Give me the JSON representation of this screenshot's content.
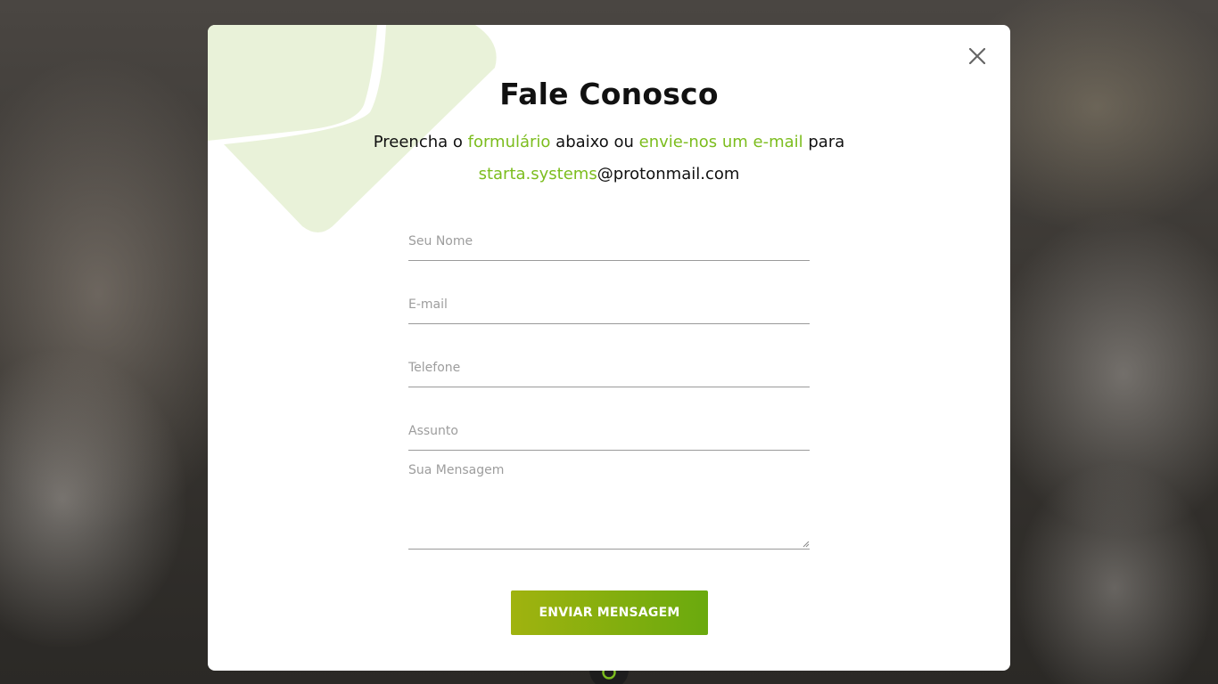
{
  "modal": {
    "title": "Fale Conosco",
    "subtitle": {
      "part1": "Preencha o ",
      "link1": "formulário",
      "part2": " abaixo ou ",
      "link2": "envie-nos um e-mail",
      "part3": " para",
      "email_user": "starta.systems",
      "email_domain": "@protonmail.com"
    },
    "close_icon": "close-icon"
  },
  "form": {
    "name_placeholder": "Seu Nome",
    "name_value": "",
    "email_placeholder": "E-mail",
    "email_value": "",
    "phone_placeholder": "Telefone",
    "phone_value": "",
    "subject_placeholder": "Assunto",
    "subject_value": "",
    "message_placeholder": "Sua Mensagem",
    "message_value": "",
    "submit_label": "ENVIAR MENSAGEM"
  },
  "colors": {
    "accent": "#7cbd1e",
    "button_start": "#a0b30f",
    "button_end": "#6aaa0e",
    "decoration": "#e9f2d9"
  },
  "background": {
    "badge_icon": "whatsapp-icon"
  }
}
